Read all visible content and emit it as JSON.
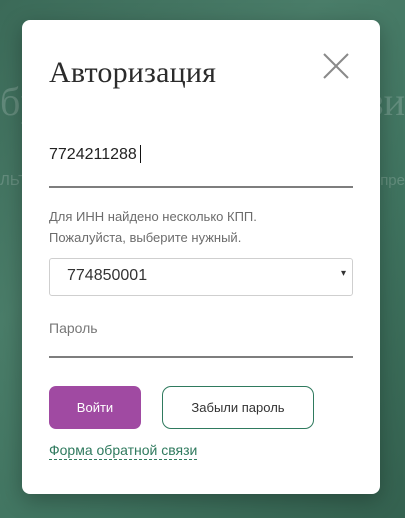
{
  "background": {
    "left_big_fragment": "бр",
    "right_big_fragment": "зи",
    "left_small_fragment": "ЛЬТ",
    "right_small_fragment": "пре"
  },
  "modal": {
    "title": "Авторизация",
    "close_icon": "close-icon",
    "inn_field": {
      "value": "7724211288"
    },
    "hint_line1": "Для ИНН найдено несколько КПП.",
    "hint_line2": "Пожалуйста, выберите нужный.",
    "kpp_select": {
      "selected_value": "774850001",
      "arrow": "▾"
    },
    "password_field": {
      "placeholder": "Пароль",
      "value": ""
    },
    "login_button": "Войти",
    "forgot_button": "Забыли пароль",
    "feedback_link": "Форма обратной связи"
  },
  "colors": {
    "accent_purple": "#a04aa2",
    "accent_green": "#2f7a5e",
    "background_green": "#4a7d69"
  }
}
